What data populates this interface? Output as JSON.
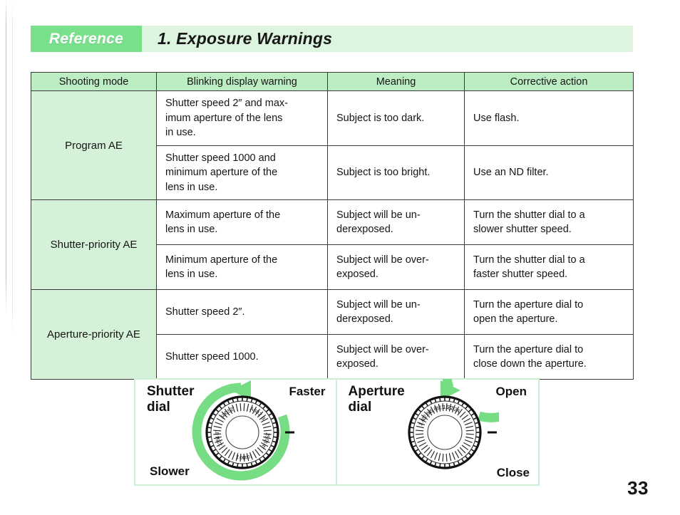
{
  "page": {
    "number": "33"
  },
  "banner": {
    "tab_label": "Reference",
    "title": "1. Exposure Warnings",
    "tab_color": "#79e08b",
    "bg_color": "#ddf5de"
  },
  "table": {
    "headers": [
      "Shooting mode",
      "Blinking display warning",
      "Meaning",
      "Corrective action"
    ],
    "header_bg": "#bdedc2",
    "mode_cell_bg": "#d5f2d9",
    "groups": [
      {
        "mode": "Program AE",
        "rows": [
          {
            "warning": "Shutter speed 2″ and max-imum aperture of the lens in use.",
            "warning_lines": [
              "Shutter speed 2″ and max-",
              "imum aperture of the lens",
              "in use."
            ],
            "meaning": "Subject is too dark.",
            "meaning_lines": [
              "Subject is too dark."
            ],
            "action": "Use flash.",
            "action_lines": [
              "Use flash."
            ]
          },
          {
            "warning": "Shutter speed 1000 and minimum aperture of the lens in use.",
            "warning_lines": [
              "Shutter speed 1000 and",
              "minimum aperture of the",
              "lens in use."
            ],
            "meaning": "Subject is too bright.",
            "meaning_lines": [
              "Subject is too bright."
            ],
            "action": "Use an ND filter.",
            "action_lines": [
              "Use an ND filter."
            ]
          }
        ]
      },
      {
        "mode": "Shutter-priority AE",
        "rows": [
          {
            "warning": "Maximum aperture of the lens in use.",
            "warning_lines": [
              "Maximum aperture of the",
              "lens in use."
            ],
            "meaning": "Subject will be underexposed.",
            "meaning_lines": [
              "Subject will be un-",
              "derexposed."
            ],
            "action": "Turn the shutter dial to a slower shutter speed.",
            "action_lines": [
              "Turn the shutter dial to a",
              "slower shutter speed."
            ]
          },
          {
            "warning": "Minimum aperture of the lens in use.",
            "warning_lines": [
              "Minimum aperture of the",
              "lens in use."
            ],
            "meaning": "Subject will be overexposed.",
            "meaning_lines": [
              "Subject will be over-",
              "exposed."
            ],
            "action": "Turn the shutter dial to a faster shutter speed.",
            "action_lines": [
              "Turn the shutter dial to a",
              "faster shutter speed."
            ]
          }
        ]
      },
      {
        "mode": "Aperture-priority AE",
        "rows": [
          {
            "warning": "Shutter speed 2″.",
            "warning_lines": [
              "Shutter speed 2″."
            ],
            "meaning": "Subject will be underexposed.",
            "meaning_lines": [
              "Subject will be un-",
              "derexposed."
            ],
            "action": "Turn the aperture dial to open the aperture.",
            "action_lines": [
              "Turn the aperture dial to",
              "open the aperture."
            ]
          },
          {
            "warning": "Shutter speed 1000.",
            "warning_lines": [
              "Shutter speed 1000."
            ],
            "meaning": "Subject will be overexposed.",
            "meaning_lines": [
              "Subject will be over-",
              "exposed."
            ],
            "action": "Turn the aperture dial to close down the aperture.",
            "action_lines": [
              "Turn the aperture dial to",
              "close down the aperture."
            ]
          }
        ]
      }
    ]
  },
  "diagram": {
    "arrow_color": "#77dd84",
    "shutter": {
      "title_line1": "Shutter",
      "title_line2": "dial",
      "label_cw": "Faster",
      "label_ccw": "Slower",
      "dial_marks": [
        "A",
        "1000",
        "500",
        "250",
        "125",
        "60",
        "30",
        "15",
        "8",
        "4",
        "2",
        "1",
        "2″",
        "4″",
        "8″",
        "B"
      ]
    },
    "aperture": {
      "title_line1": "Aperture",
      "title_line2": "dial",
      "label_cw": "Open",
      "label_ccw": "Close",
      "dial_marks": [
        "A",
        "32",
        "22",
        "16",
        "11",
        "8",
        "5.6",
        "4",
        "2.8",
        "2",
        "1.4"
      ]
    }
  }
}
